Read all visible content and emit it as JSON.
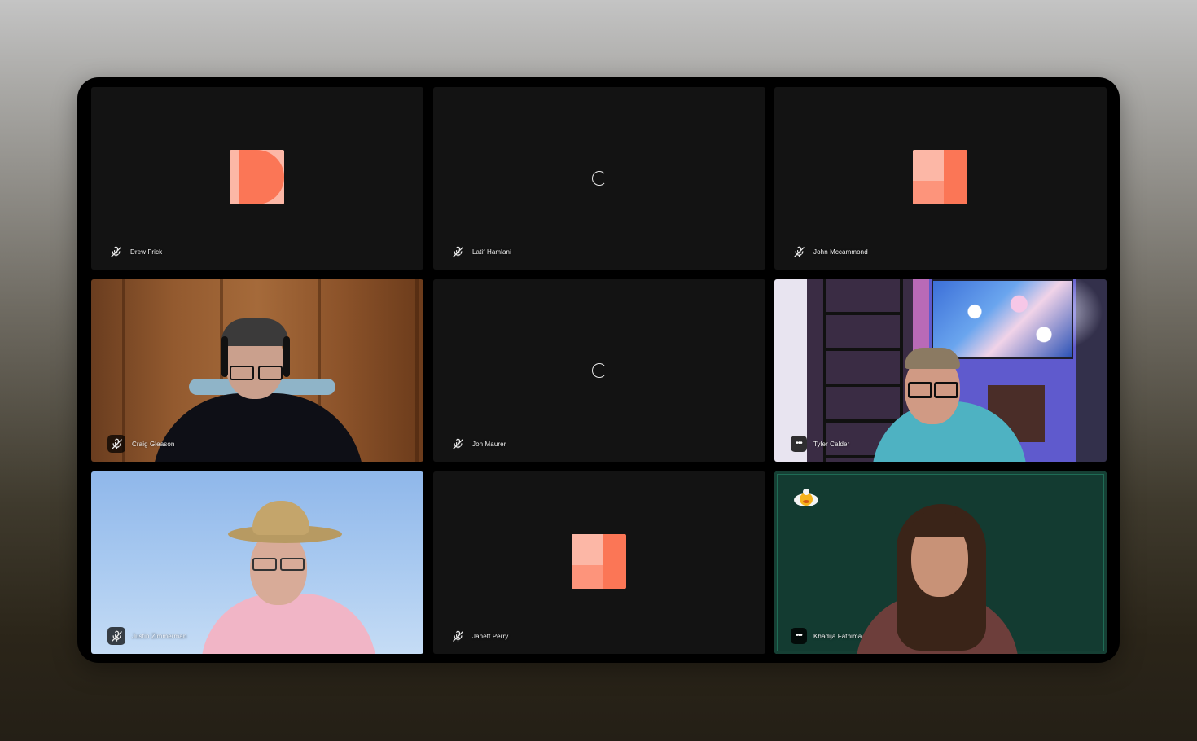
{
  "participants": [
    {
      "name": "Drew Frick",
      "view": "avatar",
      "avatar": "d-shape",
      "status_icon": "mic-muted-icon"
    },
    {
      "name": "Latif Hamlani",
      "view": "loading",
      "status_icon": "mic-muted-icon"
    },
    {
      "name": "John Mccammond",
      "view": "avatar",
      "avatar": "quad-shape",
      "status_icon": "mic-muted-icon"
    },
    {
      "name": "Craig Gleason",
      "view": "video",
      "status_icon": "mic-muted-icon"
    },
    {
      "name": "Jon Maurer",
      "view": "loading",
      "status_icon": "mic-muted-icon"
    },
    {
      "name": "Tyler Calder",
      "view": "video",
      "status_icon": "more-options-icon"
    },
    {
      "name": "Justin Zimmerman",
      "view": "video",
      "status_icon": "mic-muted-icon"
    },
    {
      "name": "Janett Perry",
      "view": "avatar",
      "avatar": "quad-shape",
      "status_icon": "mic-muted-icon"
    },
    {
      "name": "Khadija Fathima",
      "view": "video",
      "status_icon": "more-options-icon",
      "badge_icon": "duck-emoji-icon"
    }
  ],
  "colors": {
    "avatar_light": "#fcb7a6",
    "avatar_main": "#fb7656",
    "tile_bg": "#131313",
    "frame_bg": "#000000"
  }
}
